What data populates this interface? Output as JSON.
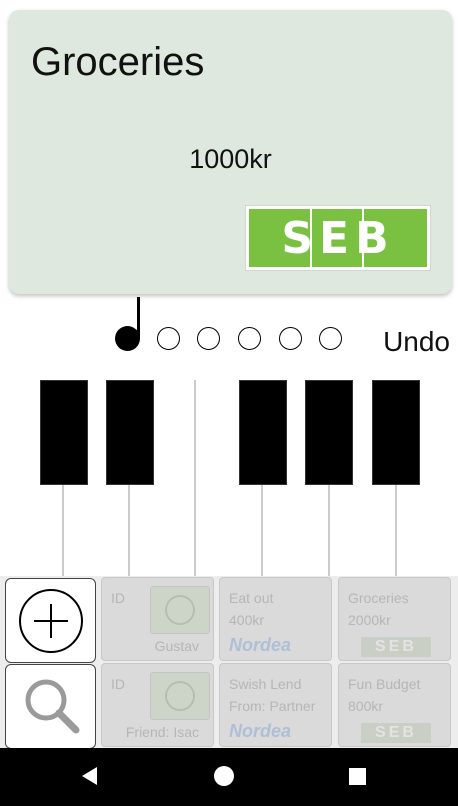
{
  "card": {
    "title": "Groceries",
    "amount": "1000kr",
    "bank_logo": "SEB"
  },
  "stepper": {
    "total_steps": 6,
    "current_step": 1,
    "undo_label": "Undo"
  },
  "toolbar": {
    "add_icon": "plus-circle-icon",
    "search_icon": "search-icon"
  },
  "tiles": [
    {
      "type": "id",
      "label": "ID",
      "name": "Gustav"
    },
    {
      "type": "budget",
      "line1": "Eat out",
      "line2": "400kr",
      "bank": "Nordea"
    },
    {
      "type": "budget",
      "line1": "Groceries",
      "line2": "2000kr",
      "bank": "SEB"
    },
    {
      "type": "id",
      "label": "ID",
      "name": "Friend: Isac"
    },
    {
      "type": "budget",
      "line1": "Swish Lend",
      "line2": "From: Partner",
      "bank": "Nordea"
    },
    {
      "type": "budget",
      "line1": "Fun Budget",
      "line2": "800kr",
      "bank": "SEB"
    }
  ],
  "colors": {
    "card_bg": "#dfe8df",
    "seb_green": "#7ac142",
    "nordea_blue": "#aebfd6"
  }
}
